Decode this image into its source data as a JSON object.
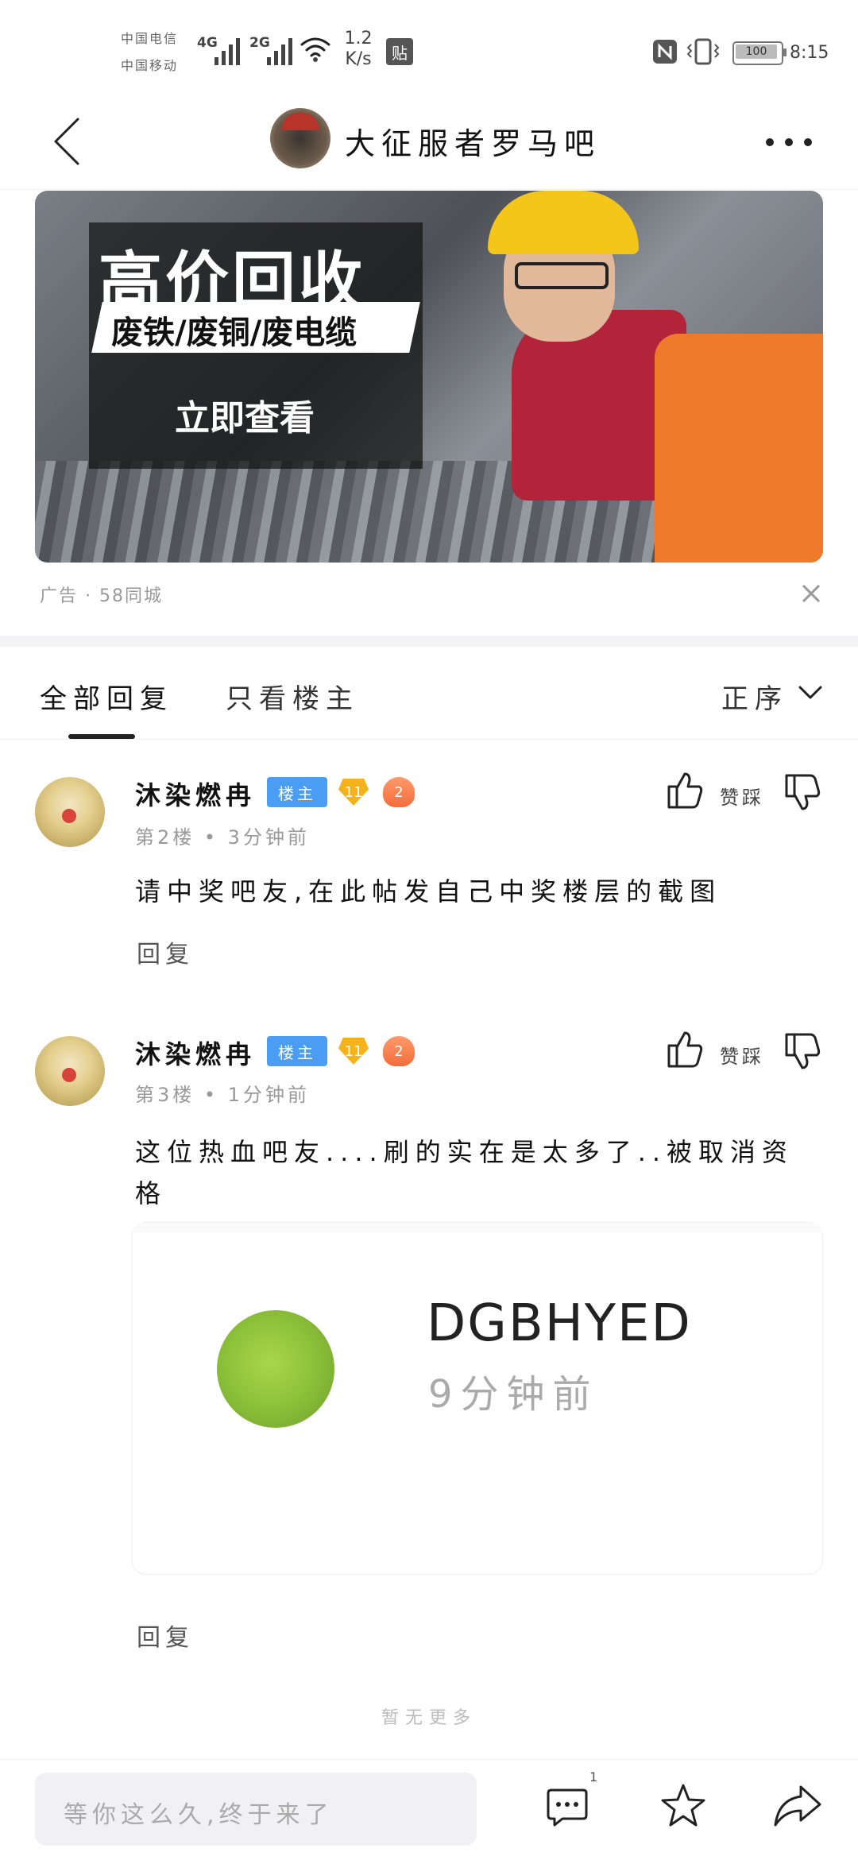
{
  "status_bar": {
    "carrier1": "中国电信",
    "carrier2": "中国移动",
    "net1": "4G",
    "net2": "2G",
    "speed": "1.2 K/s",
    "app_badge": "贴",
    "battery": "100",
    "time": "8:15"
  },
  "header": {
    "title": "大征服者罗马吧"
  },
  "ad": {
    "headline": "高价回收",
    "subline": "废铁/废铜/废电缆",
    "cta": "立即查看",
    "meta": "广告 · 58同城"
  },
  "tabs": {
    "all_replies": "全部回复",
    "only_op": "只看楼主",
    "sort": "正序"
  },
  "posts": [
    {
      "username": "沐染燃冉",
      "op_badge": "楼主",
      "level": "11",
      "sub_level": "2",
      "floor_time": "第2楼 • 3分钟前",
      "like_label": "赞",
      "dislike_label": "踩",
      "content": "请中奖吧友,在此帖发自己中奖楼层的截图",
      "reply_label": "回复"
    },
    {
      "username": "沐染燃冉",
      "op_badge": "楼主",
      "level": "11",
      "sub_level": "2",
      "floor_time": "第3楼 • 1分钟前",
      "like_label": "赞",
      "dislike_label": "踩",
      "content": "这位热血吧友....刷的实在是太多了..被取消资格",
      "quote": {
        "name": "DGBHYED",
        "time": "9分钟前"
      },
      "reply_label": "回复"
    }
  ],
  "no_more": "暂无更多",
  "bottom": {
    "input_placeholder": "等你这么久,终于来了",
    "comment_count": "1"
  }
}
